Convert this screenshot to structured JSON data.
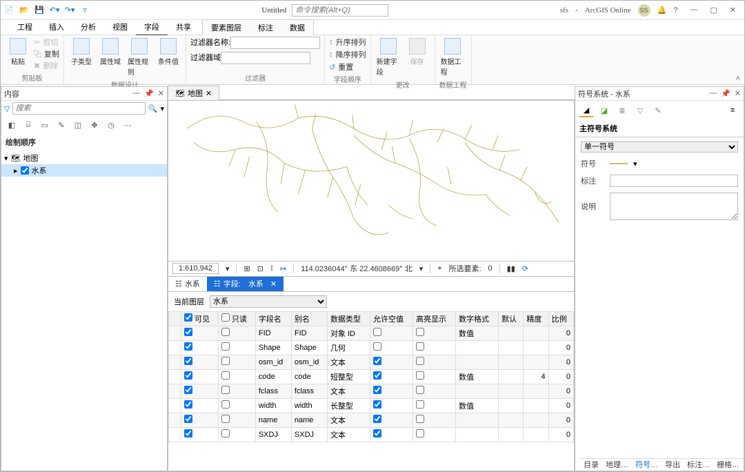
{
  "titlebar": {
    "doc_title": "Untitled",
    "search_placeholder": "命令搜索(Alt+Q)",
    "user": "sfs",
    "product": "ArcGIS Online",
    "avatar": "SS"
  },
  "ribbon_tabs": {
    "main": [
      "工程",
      "插入",
      "分析",
      "视图",
      "字段",
      "共享"
    ],
    "active": "字段",
    "context": [
      "要素图层",
      "标注",
      "数据"
    ]
  },
  "ribbon": {
    "clip_group": {
      "label": "剪贴板",
      "paste": "粘贴",
      "cut": "剪切",
      "copy": "复制",
      "delete": "删除"
    },
    "design_group": {
      "label": "数据设计",
      "subtype": "子类型",
      "domain": "属性域",
      "rules": "属性规则",
      "cond": "条件值"
    },
    "filter_group": {
      "label": "过滤器",
      "name": "过滤器名称:",
      "domain": "过滤器域"
    },
    "order_group": {
      "label": "字段顺序",
      "asc": "升序排列",
      "desc": "降序排列",
      "reset": "重置"
    },
    "change_group": {
      "label": "更改",
      "newfield": "新建字段",
      "save": "保存"
    },
    "eng_group": {
      "label": "数据工程",
      "btn": "数据工程"
    }
  },
  "contents": {
    "title": "内容",
    "search_placeholder": "搜索",
    "section": "绘制顺序",
    "map_label": "地图",
    "layer_label": "水系"
  },
  "map": {
    "tab": "地图",
    "scale": "1:610,942",
    "coord": "114.0236044° 东 22.4608669° 北",
    "selection_label": "所选要素:",
    "selection_count": "0"
  },
  "view_tabs": {
    "table": "水系",
    "fields": "字段:",
    "fields_layer": "水系"
  },
  "fields": {
    "current_label": "当前图层",
    "current_value": "水系",
    "columns": [
      "可见",
      "只读",
      "字段名",
      "别名",
      "数据类型",
      "允许空值",
      "高亮显示",
      "数字格式",
      "默认",
      "精度",
      "比例"
    ],
    "rows": [
      {
        "vis": true,
        "ro": false,
        "name": "FID",
        "alias": "FID",
        "type": "对象 ID",
        "null": false,
        "hl": false,
        "fmt": "数值",
        "def": "",
        "prec": "",
        "scale": "0"
      },
      {
        "vis": true,
        "ro": false,
        "name": "Shape",
        "alias": "Shape",
        "type": "几何",
        "null": false,
        "hl": false,
        "fmt": "",
        "def": "",
        "prec": "",
        "scale": "0"
      },
      {
        "vis": true,
        "ro": false,
        "name": "osm_id",
        "alias": "osm_id",
        "type": "文本",
        "null": true,
        "hl": false,
        "fmt": "",
        "def": "",
        "prec": "",
        "scale": "0"
      },
      {
        "vis": true,
        "ro": false,
        "name": "code",
        "alias": "code",
        "type": "短整型",
        "null": true,
        "hl": false,
        "fmt": "数值",
        "def": "",
        "prec": "4",
        "scale": "0"
      },
      {
        "vis": true,
        "ro": false,
        "name": "fclass",
        "alias": "fclass",
        "type": "文本",
        "null": true,
        "hl": false,
        "fmt": "",
        "def": "",
        "prec": "",
        "scale": "0"
      },
      {
        "vis": true,
        "ro": false,
        "name": "width",
        "alias": "width",
        "type": "长整型",
        "null": true,
        "hl": false,
        "fmt": "数值",
        "def": "",
        "prec": "",
        "scale": "0"
      },
      {
        "vis": true,
        "ro": false,
        "name": "name",
        "alias": "name",
        "type": "文本",
        "null": true,
        "hl": false,
        "fmt": "",
        "def": "",
        "prec": "",
        "scale": "0"
      },
      {
        "vis": true,
        "ro": false,
        "name": "SXDJ",
        "alias": "SXDJ",
        "type": "文本",
        "null": true,
        "hl": false,
        "fmt": "",
        "def": "",
        "prec": "",
        "scale": "0"
      }
    ]
  },
  "symbology": {
    "title": "符号系统 - 水系",
    "section": "主符号系统",
    "method": "单一符号",
    "symbol_label": "符号",
    "label_label": "标注",
    "desc_label": "说明"
  },
  "bottom_tabs": [
    "目录",
    "地理…",
    "符号…",
    "导出",
    "标注…",
    "栅格…"
  ],
  "bottom_active": "符号…"
}
